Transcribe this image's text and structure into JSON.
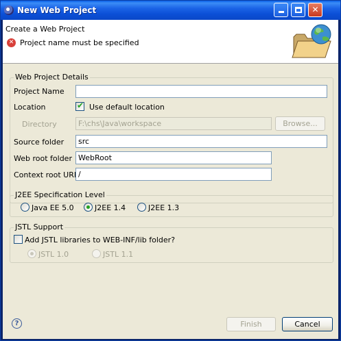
{
  "window": {
    "title": "New Web Project"
  },
  "header": {
    "title": "Create a Web Project",
    "message": "Project name must be specified"
  },
  "details": {
    "group_label": "Web Project Details",
    "project_name_label": "Project Name",
    "project_name_value": "",
    "location_label": "Location",
    "use_default_location_label": "Use default location",
    "use_default_location_checked": true,
    "directory_label": "Directory",
    "directory_value": "F:\\chs\\Java\\workspace",
    "browse_label": "Browse...",
    "source_folder_label": "Source folder",
    "source_folder_value": "src",
    "web_root_folder_label": "Web root folder",
    "web_root_folder_value": "WebRoot",
    "context_root_label": "Context root URL",
    "context_root_value": "/"
  },
  "j2ee": {
    "group_label": "J2EE Specification Level",
    "options": [
      "Java EE 5.0",
      "J2EE 1.4",
      "J2EE 1.3"
    ],
    "selected": "J2EE 1.4"
  },
  "jstl": {
    "group_label": "JSTL Support",
    "add_label": "Add JSTL libraries to WEB-INF/lib folder?",
    "add_checked": false,
    "options": [
      "JSTL 1.0",
      "JSTL 1.1"
    ],
    "selected": "JSTL 1.0"
  },
  "footer": {
    "finish_label": "Finish",
    "cancel_label": "Cancel"
  }
}
